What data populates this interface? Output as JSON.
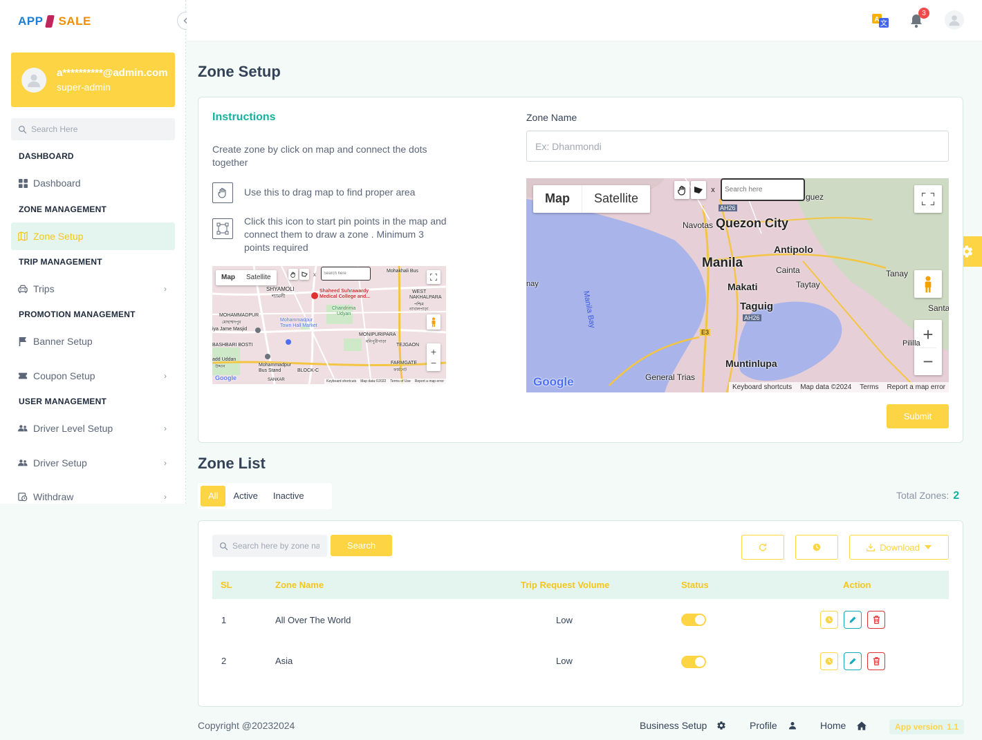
{
  "brand": {
    "part1": "APP",
    "part2": "SALE"
  },
  "profile": {
    "email": "a**********@admin.com",
    "role": "super-admin"
  },
  "sidebar": {
    "search_placeholder": "Search Here",
    "sections": {
      "dashboard": "DASHBOARD",
      "zone": "ZONE MANAGEMENT",
      "trip": "TRIP MANAGEMENT",
      "promotion": "PROMOTION MANAGEMENT",
      "user": "USER MANAGEMENT"
    },
    "items": {
      "dashboard": "Dashboard",
      "zone_setup": "Zone Setup",
      "trips": "Trips",
      "banner_setup": "Banner Setup",
      "coupon_setup": "Coupon Setup",
      "driver_level_setup": "Driver Level Setup",
      "driver_setup": "Driver Setup",
      "withdraw": "Withdraw"
    }
  },
  "topbar": {
    "notification_count": "3"
  },
  "page": {
    "title": "Zone Setup"
  },
  "instructions": {
    "title": "Instructions",
    "intro": "Create zone by click on map and connect the dots together",
    "drag_text": "Use this to drag map to find proper area",
    "pin_text": "Click this icon to start pin points in the map and connect them to draw a zone . Minimum 3 points required"
  },
  "small_map": {
    "map_btn": "Map",
    "satellite_btn": "Satellite",
    "search_placeholder": "Search here",
    "close": "x",
    "labels": {
      "mohakhali": "Mohakhali Bus",
      "shyamoli": "SHYAMOLI",
      "shyamoli_bn": "শ্যামলী",
      "hospital1": "Shaheed Suhrawardy",
      "hospital2": "Medical College and...",
      "west_nakhal": "WEST",
      "west_nakhal2": "NAKHALPARA",
      "west_bn": "পশ্চিম",
      "nakhal_bn": "নাখালপাড়া",
      "mohammadpur": "MOHAMMADPUR",
      "mohammadpur_bn": "মোহাম্মদপুর",
      "chandrima": "Chandrima",
      "udyan": "Udyan",
      "town_hall1": "Mohammadpur",
      "town_hall2": "Town Hall Market",
      "jame_masjid": "iya Jame Masjid",
      "monipuripara": "MONIPURIPARA",
      "monipuripara_bn": "মনিপুরীপাড়া",
      "bashbari": "BASHBARI BOSTI",
      "tejgaon": "TEJGAON",
      "farmgate": "FARMGATE",
      "farmgate_bn": "ফার্মগেট",
      "uddan": "add Uddan",
      "uddan_bn": "উদ্দান",
      "bus_stand1": "Mohammadpur",
      "bus_stand2": "Bus Stand",
      "block_c": "BLOCK-C",
      "sankar": "SANKAR"
    },
    "footer": {
      "shortcuts": "Keyboard shortcuts",
      "data": "Map data ©2022",
      "terms": "Terms of Use",
      "report": "Report a map error"
    }
  },
  "zone_form": {
    "label": "Zone Name",
    "placeholder": "Ex: Dhanmondi",
    "submit": "Submit"
  },
  "big_map": {
    "map_btn": "Map",
    "satellite_btn": "Satellite",
    "search_placeholder": "Search here",
    "close": "x",
    "labels": {
      "quezon": "Quezon City",
      "navotas": "Navotas",
      "manila": "Manila",
      "antipolo": "Antipolo",
      "cainta": "Cainta",
      "taytay": "Taytay",
      "makati": "Makati",
      "taguig": "Taguig",
      "tanay": "Tanay",
      "santa": "Santa",
      "pililla": "Pililla",
      "muntinlupa": "Muntinlupa",
      "general_trias": "General Trias",
      "manila_bay": "Manila Bay",
      "nay": "nay",
      "guez": "guez",
      "ah26a": "AH26",
      "ah26b": "AH26",
      "e3": "E3",
      "google": "Google"
    },
    "footer": {
      "shortcuts": "Keyboard shortcuts",
      "data": "Map data ©2024",
      "terms": "Terms",
      "report": "Report a map error"
    }
  },
  "zone_list": {
    "title": "Zone List",
    "tabs": [
      "All",
      "Active",
      "Inactive"
    ],
    "total_label": "Total Zones:",
    "total_value": "2",
    "search_placeholder": "Search here by zone name",
    "search_btn": "Search",
    "download_btn": "Download",
    "columns": [
      "SL",
      "Zone Name",
      "Trip Request Volume",
      "Status",
      "Action"
    ],
    "rows": [
      {
        "sl": "1",
        "name": "All Over The World",
        "volume": "Low",
        "status": true
      },
      {
        "sl": "2",
        "name": "Asia",
        "volume": "Low",
        "status": true
      }
    ]
  },
  "footer": {
    "copyright": "Copyright @20232024",
    "business_setup": "Business Setup",
    "profile": "Profile",
    "home": "Home",
    "version_label": "App version",
    "version": "1.1"
  },
  "colors": {
    "primary": "#fdd444",
    "teal": "#14b19e",
    "danger": "#e03131",
    "info": "#15aabf"
  }
}
